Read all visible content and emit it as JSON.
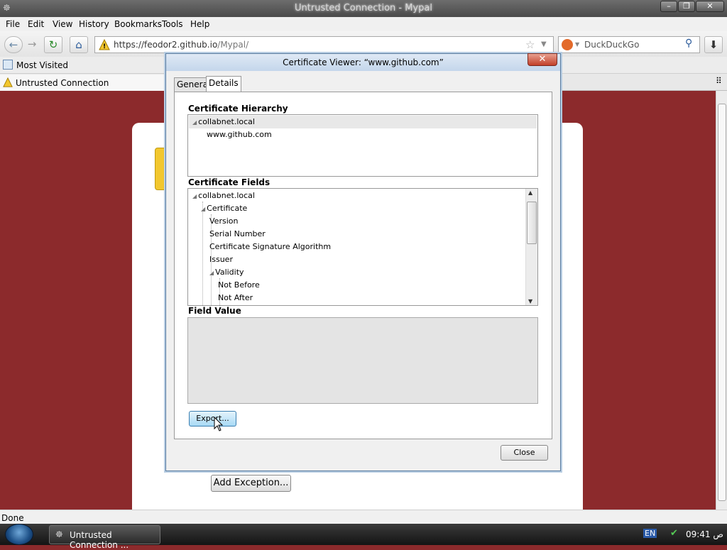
{
  "window": {
    "title": "Untrusted Connection - Mypal"
  },
  "menu": [
    "File",
    "Edit",
    "View",
    "History",
    "Bookmarks",
    "Tools",
    "Help"
  ],
  "nav": {
    "url_host": "https://feodor2.github.io",
    "url_path": "/Mypal/",
    "search_placeholder": "DuckDuckGo"
  },
  "bookmarks": {
    "item": "Most Visited"
  },
  "tab": {
    "label": "Untrusted Connection"
  },
  "page": {
    "add_exception": "Add Exception..."
  },
  "status": {
    "text": "Done"
  },
  "taskbar": {
    "item": "Untrusted Connection ...",
    "lang": "EN",
    "time": "09:41 ص"
  },
  "dialog": {
    "title": "Certificate Viewer: “www.github.com”",
    "tabs": [
      "General",
      "Details"
    ],
    "hierarchy_label": "Certificate Hierarchy",
    "hierarchy": [
      "collabnet.local",
      "www.github.com"
    ],
    "fields_label": "Certificate Fields",
    "fields": [
      {
        "label": "collabnet.local",
        "level": 0,
        "expanded": true
      },
      {
        "label": "Certificate",
        "level": 1,
        "expanded": true
      },
      {
        "label": "Version",
        "level": 2
      },
      {
        "label": "Serial Number",
        "level": 2
      },
      {
        "label": "Certificate Signature Algorithm",
        "level": 2
      },
      {
        "label": "Issuer",
        "level": 2
      },
      {
        "label": "Validity",
        "level": 2,
        "expanded": true
      },
      {
        "label": "Not Before",
        "level": 3
      },
      {
        "label": "Not After",
        "level": 3
      }
    ],
    "value_label": "Field Value",
    "export_label": "Export...",
    "close_label": "Close"
  },
  "colors": {
    "page_bg": "#8c2a2c",
    "accent": "#3c7fb1"
  }
}
